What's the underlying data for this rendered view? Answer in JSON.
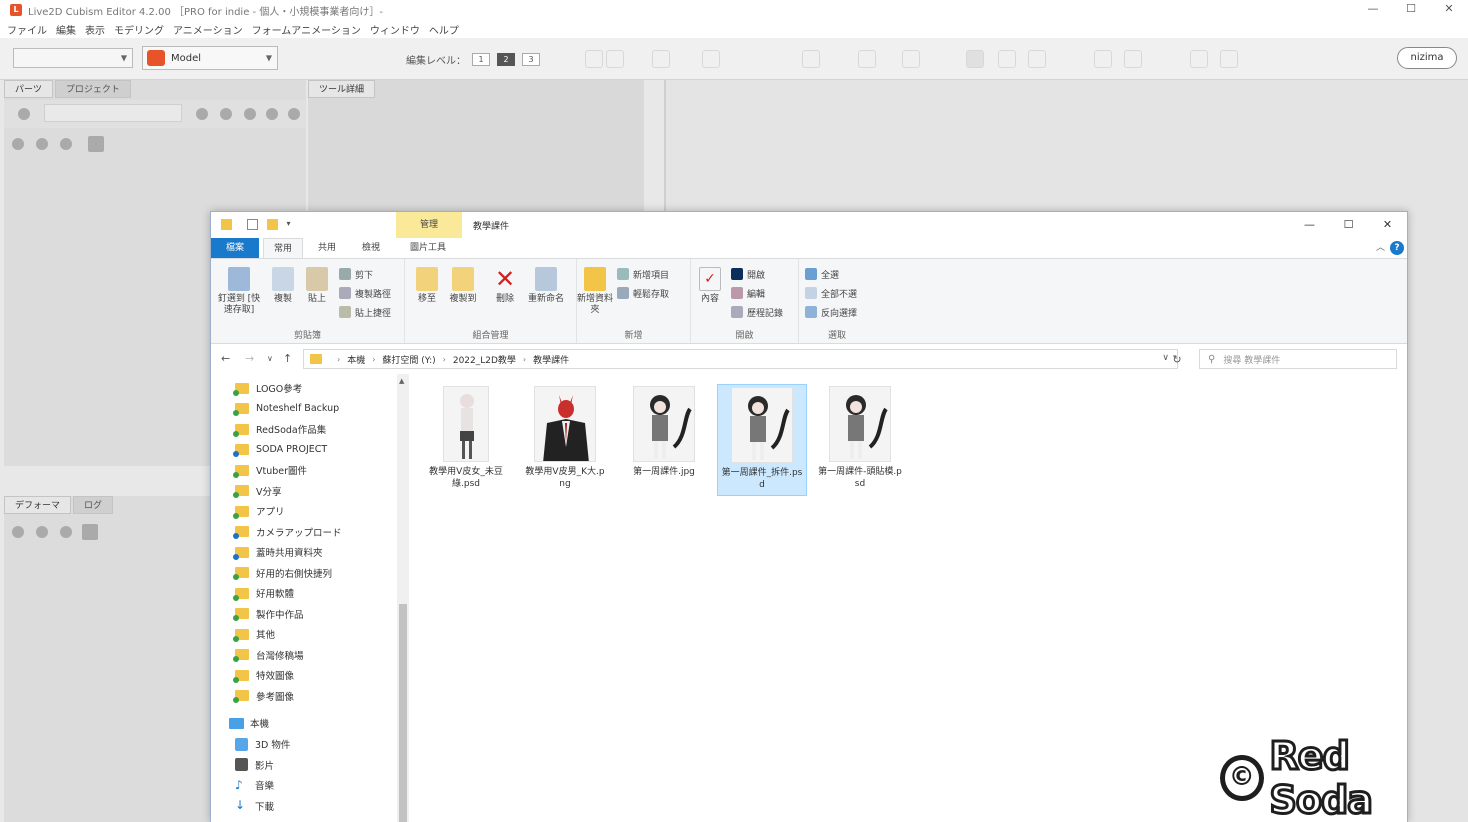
{
  "app": {
    "title": "Live2D Cubism Editor 4.2.00 ［PRO for indie - 個人・小規模事業者向け］-",
    "window_controls": [
      "—",
      "☐",
      "✕"
    ]
  },
  "menu": [
    "ファイル",
    "編集",
    "表示",
    "モデリング",
    "アニメーション",
    "フォームアニメーション",
    "ウィンドウ",
    "ヘルプ"
  ],
  "toolbar": {
    "model_select": "Model",
    "edit_level_label": "編集レベル：",
    "edit_levels": [
      "1",
      "2",
      "3"
    ],
    "active_level": "2",
    "nizima": "nizima"
  },
  "left_panel": {
    "tabs": [
      "パーツ",
      "プロジェクト"
    ]
  },
  "tool_detail_panel": {
    "tabs": [
      "ツール詳細"
    ]
  },
  "bottom_panel": {
    "tabs": [
      "デフォーマ",
      "ログ"
    ]
  },
  "explorer": {
    "context_tab": "管理",
    "title": "教學課件",
    "window_controls": [
      "—",
      "☐",
      "✕"
    ],
    "ribbon_tabs": [
      "檔案",
      "常用",
      "共用",
      "檢視",
      "圖片工具"
    ],
    "ribbon": {
      "clipboard": {
        "pin": "釘選到 [快速存取]",
        "copy": "複製",
        "paste": "貼上",
        "cut": "剪下",
        "copy_path": "複製路徑",
        "paste_shortcut": "貼上捷徑",
        "label": "剪貼簿"
      },
      "organize": {
        "move": "移至",
        "copy_to": "複製到",
        "delete": "刪除",
        "rename": "重新命名",
        "label": "組合管理"
      },
      "new": {
        "new_folder": "新增資料夾",
        "new_item": "新增項目",
        "easy_access": "輕鬆存取",
        "label": "新增"
      },
      "open": {
        "properties": "內容",
        "open": "開啟",
        "edit": "編輯",
        "history": "歷程記錄",
        "label": "開啟"
      },
      "select": {
        "select_all": "全選",
        "select_none": "全部不選",
        "invert": "反向選擇",
        "label": "選取"
      }
    },
    "address": {
      "crumbs": [
        "本機",
        "蘇打空間 (Y:)",
        "2022_L2D教學",
        "教學課件"
      ],
      "search_placeholder": "搜尋 教學課件"
    },
    "nav_items": [
      {
        "label": "LOGO參考",
        "shared": false
      },
      {
        "label": "Noteshelf Backup",
        "shared": false
      },
      {
        "label": "RedSoda作品集",
        "shared": false
      },
      {
        "label": "SODA PROJECT",
        "shared": true
      },
      {
        "label": "Vtuber圖件",
        "shared": false
      },
      {
        "label": "V分享",
        "shared": false
      },
      {
        "label": "アプリ",
        "shared": false
      },
      {
        "label": "カメラアップロード",
        "shared": true
      },
      {
        "label": "蓋時共用資料夾",
        "shared": true
      },
      {
        "label": "好用的右側快捷列",
        "shared": false
      },
      {
        "label": "好用軟體",
        "shared": false
      },
      {
        "label": "製作中作品",
        "shared": false
      },
      {
        "label": "其他",
        "shared": false
      },
      {
        "label": "台灣修稿場",
        "shared": false
      },
      {
        "label": "特效圖像",
        "shared": false
      },
      {
        "label": "參考圖像",
        "shared": false
      }
    ],
    "this_pc": "本機",
    "pc_items": [
      "3D 物件",
      "影片",
      "音樂",
      "下載"
    ],
    "files": [
      {
        "name": "教學用V皮女_未豆綠.psd",
        "thumb": "girl"
      },
      {
        "name": "教學用V皮男_K大.png",
        "thumb": "demon"
      },
      {
        "name": "第一周課件.jpg",
        "thumb": "cat"
      },
      {
        "name": "第一周課件_拆件.psd",
        "thumb": "cat",
        "selected": true
      },
      {
        "name": "第一周課件-頭貼模.psd",
        "thumb": "cat"
      }
    ]
  },
  "watermark": {
    "symbol": "©",
    "text": "Red Soda"
  }
}
